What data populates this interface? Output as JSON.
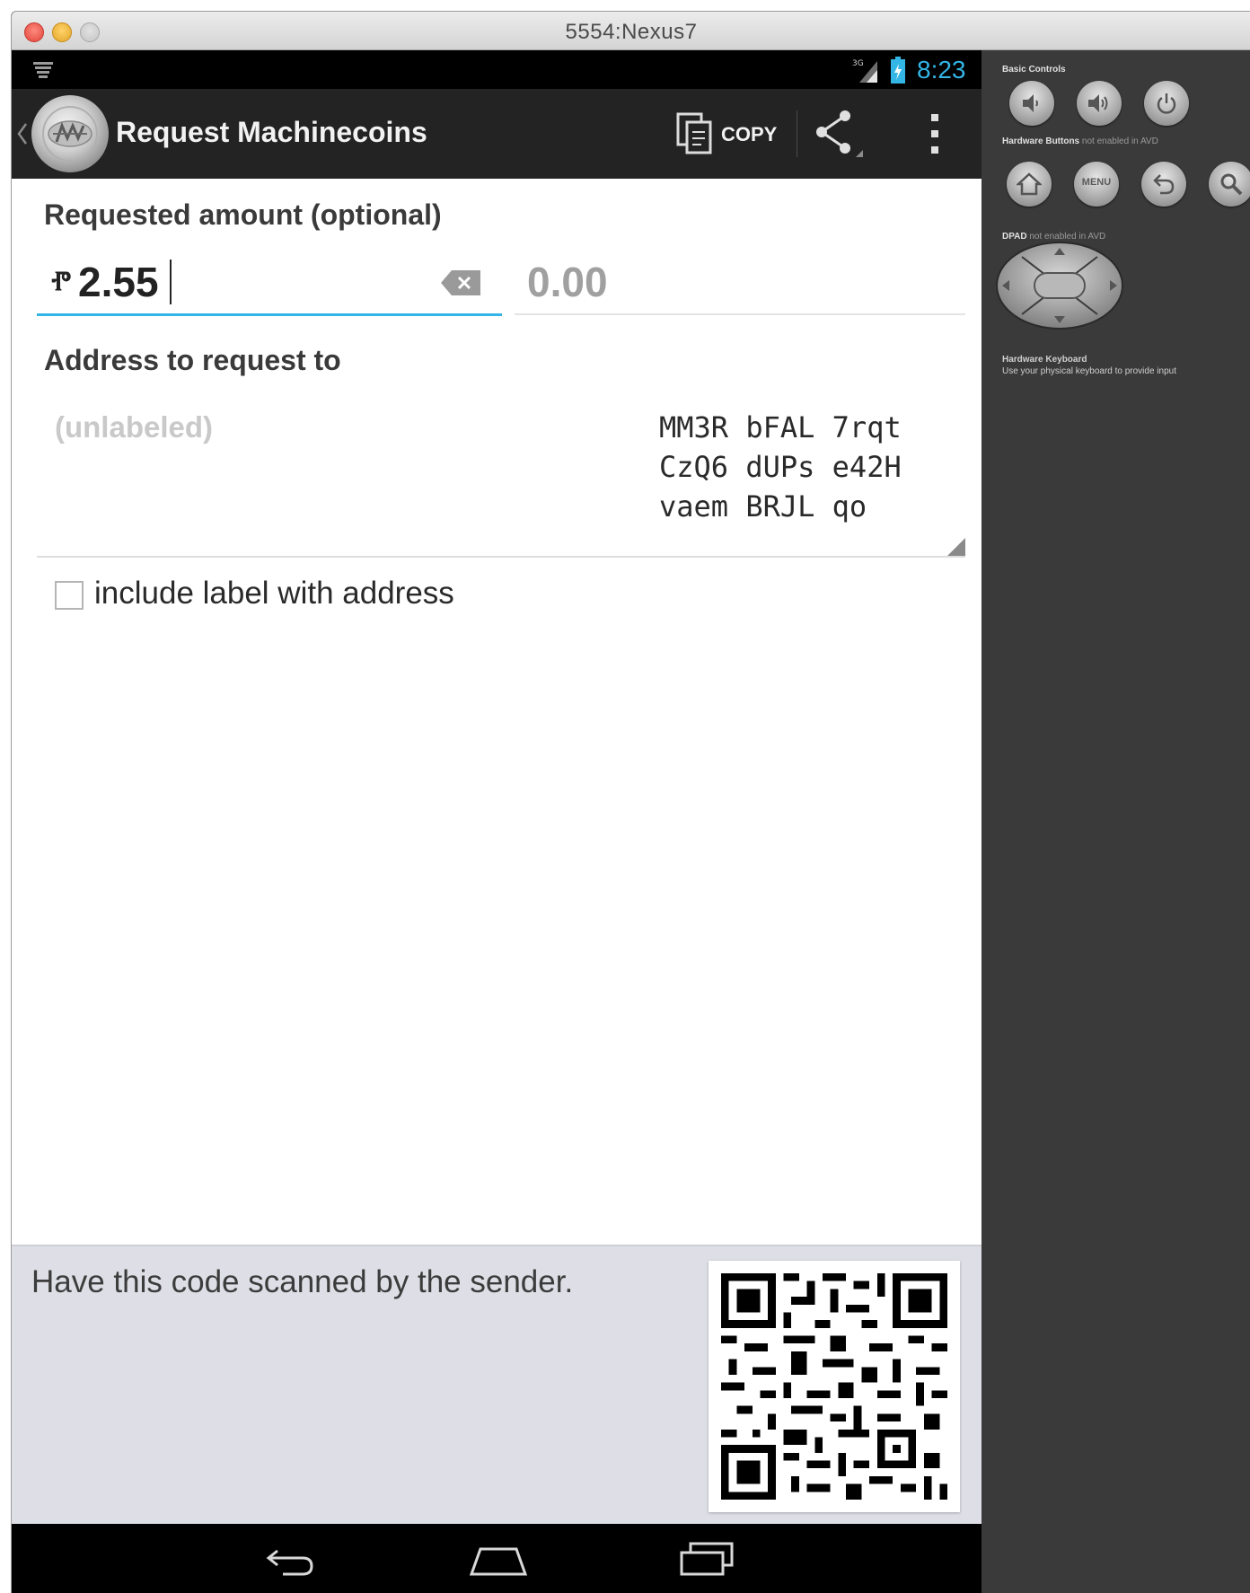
{
  "window": {
    "title": "5554:Nexus7"
  },
  "status_bar": {
    "time": "8:23",
    "network": "3G"
  },
  "action_bar": {
    "title": "Request Machinecoins",
    "copy_label": "COPY",
    "icons": [
      "back-caret-icon",
      "app-logo",
      "copy-icon",
      "share-icon",
      "overflow-menu-icon"
    ]
  },
  "form": {
    "amount_section_label": "Requested amount (optional)",
    "amount_prefix": "Ⱂ",
    "amount_value": "2.55",
    "fiat_value": "0.00",
    "address_section_label": "Address to request to",
    "address_label": "(unlabeled)",
    "address_lines": [
      "MM3R bFAL 7rqt",
      "CzQ6 dUPs e42H",
      "vaem BRJL qo"
    ],
    "include_label_checkbox": {
      "label": "include label with address",
      "checked": false
    }
  },
  "qr_panel": {
    "hint": "Have this code scanned by the sender."
  },
  "emulator_controls": {
    "basic_controls_heading": "Basic Controls",
    "hardware_buttons_heading": "Hardware Buttons",
    "hardware_buttons_note": "not enabled in AVD",
    "dpad_heading": "DPAD",
    "dpad_note": "not enabled in AVD",
    "keyboard_heading": "Hardware Keyboard",
    "keyboard_note": "Use your physical keyboard to provide input",
    "menu_label": "MENU"
  },
  "colors": {
    "accent": "#33b5e5",
    "action_bar": "#232323",
    "qr_panel": "#dedee6"
  }
}
